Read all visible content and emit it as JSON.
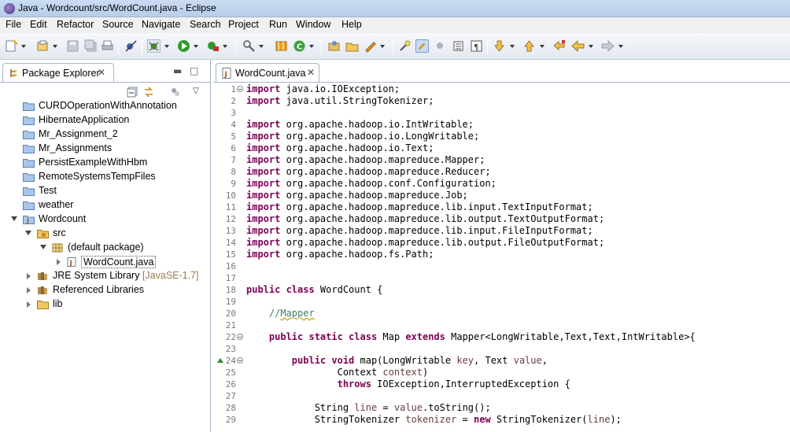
{
  "window": {
    "title": "Java - Wordcount/src/WordCount.java - Eclipse"
  },
  "menu": [
    "File",
    "Edit",
    "Refactor",
    "Source",
    "Navigate",
    "Search",
    "Project",
    "Run",
    "Window",
    "Help"
  ],
  "package_explorer": {
    "tab_label": "Package Explorer",
    "items": [
      {
        "label": "CURDOperationWithAnnotation",
        "icon": "project-folder-icon"
      },
      {
        "label": "HibernateApplication",
        "icon": "project-folder-icon"
      },
      {
        "label": "Mr_Assignment_2",
        "icon": "project-folder-icon"
      },
      {
        "label": "Mr_Assignments",
        "icon": "project-folder-icon"
      },
      {
        "label": "PersistExampleWithHbm",
        "icon": "project-folder-icon"
      },
      {
        "label": "RemoteSystemsTempFiles",
        "icon": "project-folder-icon"
      },
      {
        "label": "Test",
        "icon": "project-folder-icon"
      },
      {
        "label": "weather",
        "icon": "project-folder-icon"
      },
      {
        "label": "Wordcount",
        "icon": "java-project-icon",
        "expanded": true
      },
      {
        "label": "src",
        "icon": "source-folder-icon",
        "expanded": true
      },
      {
        "label": "(default package)",
        "icon": "package-icon",
        "expanded": true
      },
      {
        "label": "WordCount.java",
        "icon": "java-file-icon",
        "selected": true
      },
      {
        "label": "JRE System Library",
        "decoration": "[JavaSE-1.7]",
        "icon": "library-icon"
      },
      {
        "label": "Referenced Libraries",
        "icon": "library-icon"
      },
      {
        "label": "lib",
        "icon": "folder-icon"
      }
    ]
  },
  "editor": {
    "tab_label": "WordCount.java",
    "lines": [
      {
        "n": "1",
        "text": "import java.io.IOException;"
      },
      {
        "n": "2",
        "text": "import java.util.StringTokenizer;"
      },
      {
        "n": "3",
        "text": ""
      },
      {
        "n": "4",
        "text": "import org.apache.hadoop.io.IntWritable;"
      },
      {
        "n": "5",
        "text": "import org.apache.hadoop.io.LongWritable;"
      },
      {
        "n": "6",
        "text": "import org.apache.hadoop.io.Text;"
      },
      {
        "n": "7",
        "text": "import org.apache.hadoop.mapreduce.Mapper;"
      },
      {
        "n": "8",
        "text": "import org.apache.hadoop.mapreduce.Reducer;"
      },
      {
        "n": "9",
        "text": "import org.apache.hadoop.conf.Configuration;"
      },
      {
        "n": "10",
        "text": "import org.apache.hadoop.mapreduce.Job;"
      },
      {
        "n": "11",
        "text": "import org.apache.hadoop.mapreduce.lib.input.TextInputFormat;"
      },
      {
        "n": "12",
        "text": "import org.apache.hadoop.mapreduce.lib.output.TextOutputFormat;"
      },
      {
        "n": "13",
        "text": "import org.apache.hadoop.mapreduce.lib.input.FileInputFormat;"
      },
      {
        "n": "14",
        "text": "import org.apache.hadoop.mapreduce.lib.output.FileOutputFormat;"
      },
      {
        "n": "15",
        "text": "import org.apache.hadoop.fs.Path;"
      },
      {
        "n": "16",
        "text": ""
      },
      {
        "n": "17",
        "text": ""
      },
      {
        "n": "18",
        "text": "public class WordCount {"
      },
      {
        "n": "19",
        "text": ""
      },
      {
        "n": "20",
        "text": "    //Mapper"
      },
      {
        "n": "21",
        "text": ""
      },
      {
        "n": "22",
        "text": "    public static class Map extends Mapper<LongWritable,Text,Text,IntWritable>{"
      },
      {
        "n": "23",
        "text": ""
      },
      {
        "n": "24",
        "text": "        public void map(LongWritable key, Text value,"
      },
      {
        "n": "25",
        "text": "                Context context)"
      },
      {
        "n": "26",
        "text": "                throws IOException,InterruptedException {"
      },
      {
        "n": "27",
        "text": ""
      },
      {
        "n": "28",
        "text": "            String line = value.toString();"
      },
      {
        "n": "29",
        "text": "            StringTokenizer tokenizer = new StringTokenizer(line);"
      }
    ]
  }
}
